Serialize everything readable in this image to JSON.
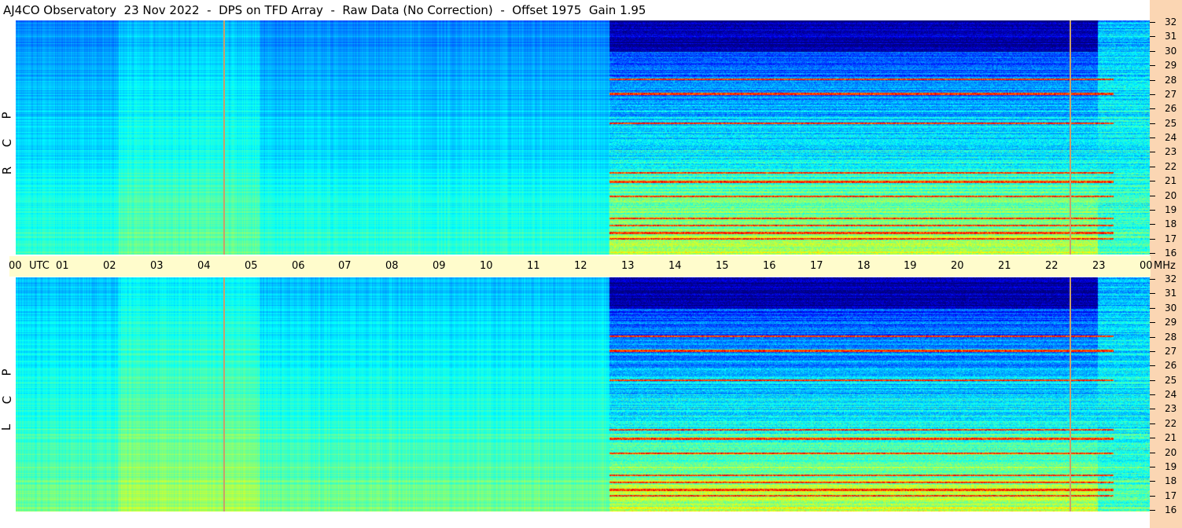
{
  "title": "AJ4CO Observatory  23 Nov 2022  -  DPS on TFD Array  -  Raw Data (No Correction)  -  Offset 1975  Gain 1.95",
  "colors": {
    "background": "#ffffff",
    "time_axis_bg": "#fffccc",
    "freq_axis_bg": "#fbd6b3",
    "marker": "#caa06a"
  },
  "chart_data": {
    "type": "heatmap",
    "description": "dynamic spectrogram",
    "x_axis": {
      "ticks": [
        "00",
        "01",
        "02",
        "03",
        "04",
        "05",
        "06",
        "07",
        "08",
        "09",
        "10",
        "11",
        "12",
        "13",
        "14",
        "15",
        "16",
        "17",
        "18",
        "19",
        "20",
        "21",
        "22",
        "23",
        "00"
      ],
      "unit_label": "UTC",
      "range": [
        0,
        24
      ]
    },
    "y_axis": {
      "ticks": [
        "16",
        "17",
        "18",
        "19",
        "20",
        "21",
        "22",
        "23",
        "24",
        "25",
        "26",
        "27",
        "28",
        "29",
        "30",
        "31",
        "32"
      ],
      "unit_label": "MHz",
      "range": [
        16,
        32
      ]
    },
    "panels": [
      {
        "id": "rcp",
        "letters": [
          "R",
          "C",
          "P"
        ]
      },
      {
        "id": "lcp",
        "letters": [
          "L",
          "C",
          "P"
        ]
      }
    ],
    "markers_utc": [
      4.4,
      22.3
    ],
    "active_region_start_utc": 12.55,
    "active_region_end_utc": 22.9,
    "bright_bands_mhz": [
      17.1,
      17.5,
      18.0,
      18.5,
      20.0,
      21.0,
      21.6,
      25.0,
      27.0,
      28.0
    ]
  }
}
